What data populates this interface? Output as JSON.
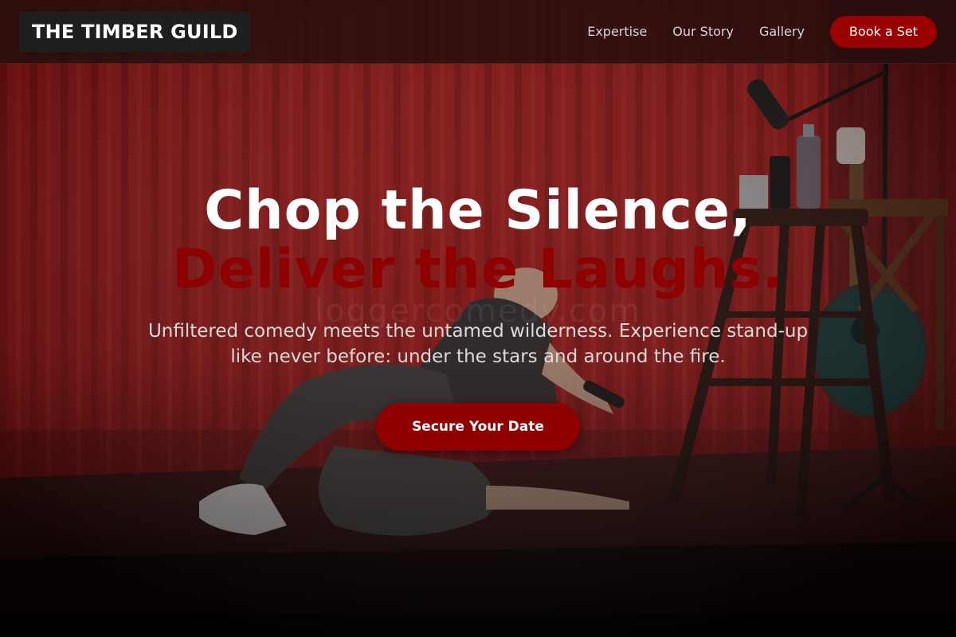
{
  "brand": {
    "logo_text": "THE TIMBER GUILD"
  },
  "nav": {
    "links": [
      {
        "label": "Expertise"
      },
      {
        "label": "Our Story"
      },
      {
        "label": "Gallery"
      }
    ],
    "cta_label": "Book a Set"
  },
  "hero": {
    "title_line1": "Chop the Silence,",
    "title_line2": "Deliver the Laughs.",
    "subtitle": "Unfiltered comedy meets the untamed wilderness. Experience stand-up like never before: under the stars and around the fire.",
    "cta_label": "Secure Your Date",
    "watermark": "loggercomedy.com"
  },
  "colors": {
    "accent": "#9b0000",
    "headline_accent": "#8e0000",
    "header_bg": "#240e0e",
    "logo_bg": "#1f1f1f"
  },
  "icons": {
    "background_image": "comedian-on-stage-photo"
  }
}
